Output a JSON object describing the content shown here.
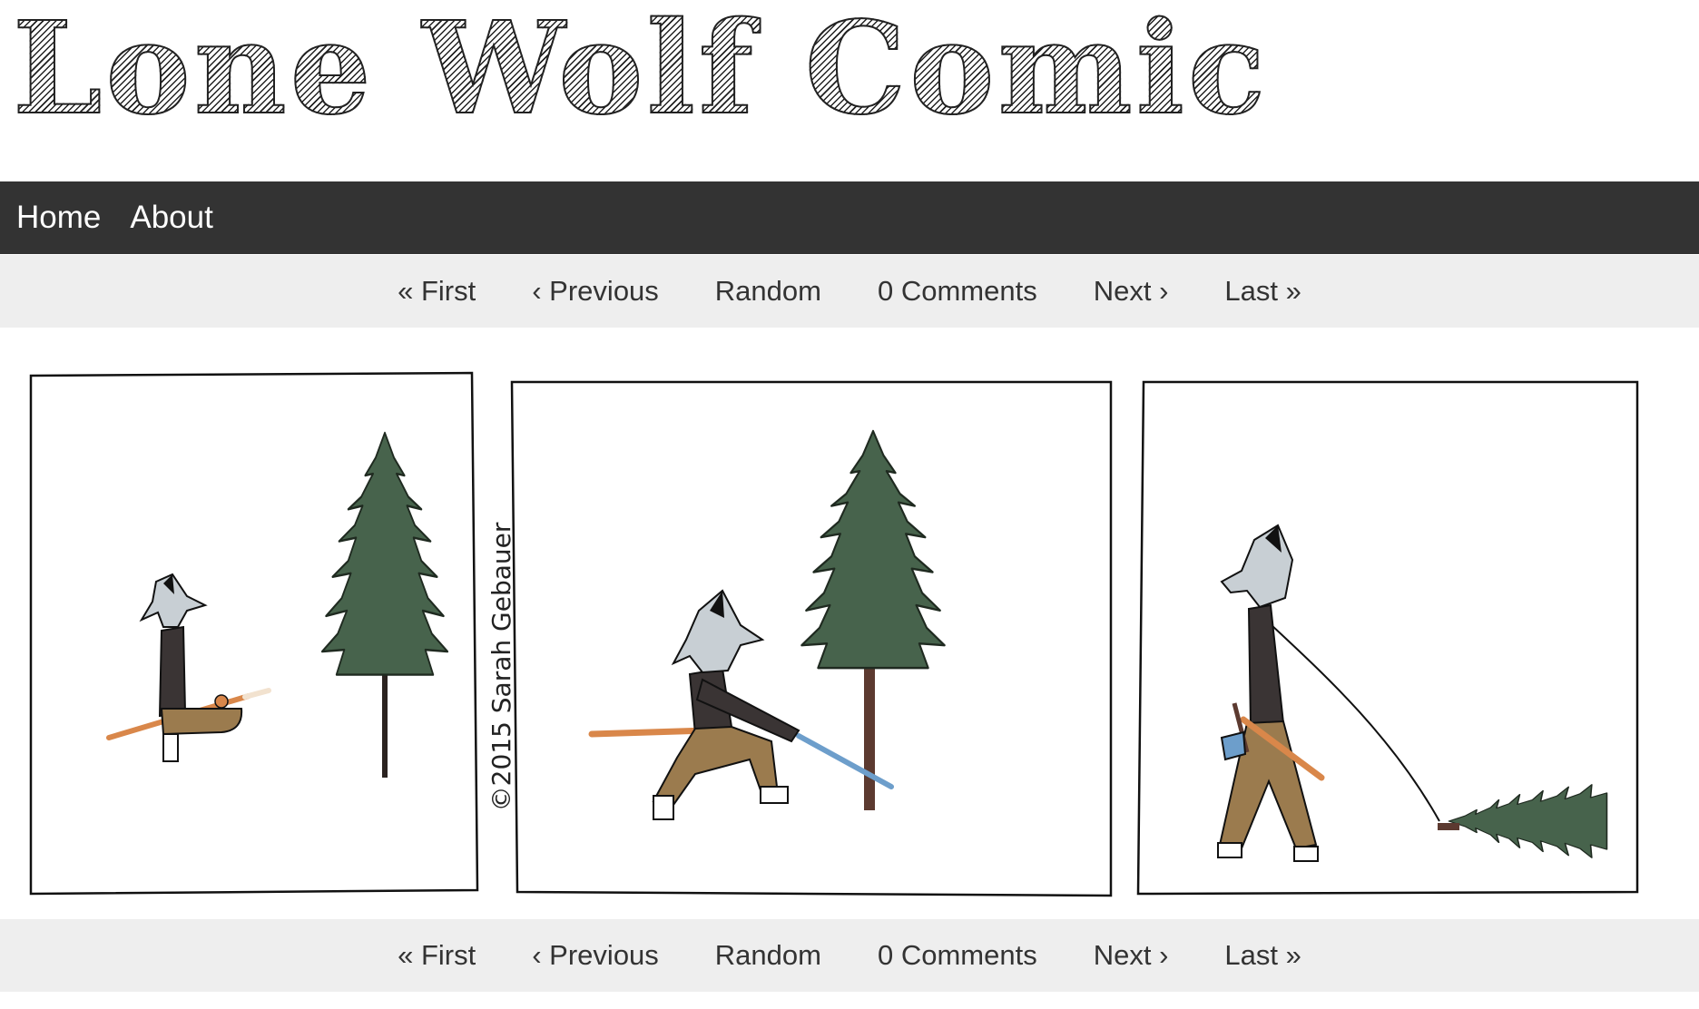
{
  "site": {
    "title": "Lone Wolf Comic"
  },
  "nav": {
    "items": [
      {
        "label": "Home"
      },
      {
        "label": "About"
      }
    ]
  },
  "comic_nav": {
    "first": "« First",
    "previous": "‹ Previous",
    "random": "Random",
    "comments": "0 Comments",
    "next": "Next ›",
    "last": "Last »"
  },
  "comic": {
    "panels": 3,
    "signature": "©2015 Sarah Gebauer"
  },
  "colors": {
    "nav_bg": "#333333",
    "comic_nav_bg": "#eeeeee",
    "tree_green": "#47634c",
    "wolf_grey": "#c8cfd4",
    "pants_brown": "#9b7b4e",
    "shirt_dark": "#3a3434",
    "staff_orange": "#d9874a",
    "blade_blue": "#6d9ecb"
  }
}
